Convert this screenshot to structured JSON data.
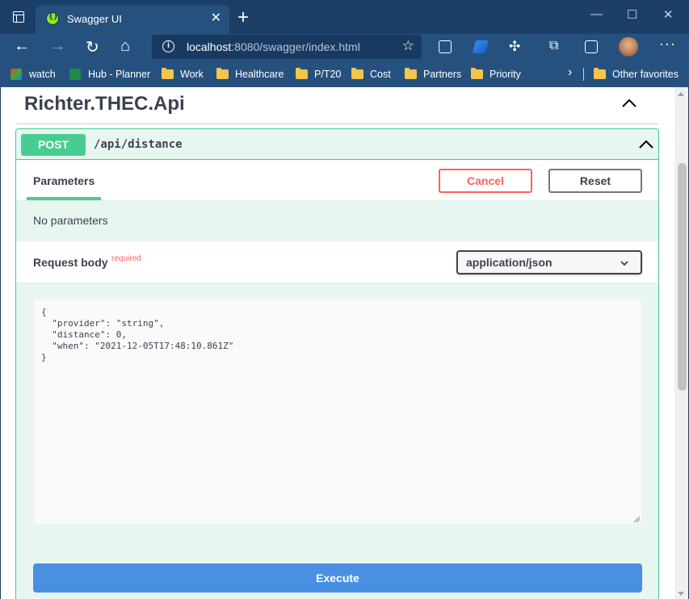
{
  "browser": {
    "tab_title": "Swagger UI",
    "tab_close": "✕",
    "new_tab": "+",
    "window_controls": {
      "minimize": "—",
      "maximize": "☐",
      "close": "✕"
    },
    "nav": {
      "back": "←",
      "forward": "→",
      "refresh": "↻",
      "home": "⌂"
    },
    "url_host": "localhost",
    "url_path": ":8080/swagger/index.html",
    "more_label": "···",
    "favorites": [
      {
        "label": "watch",
        "icon": "watch-site-icon"
      },
      {
        "label": "Hub - Planner",
        "icon": "planner-icon"
      },
      {
        "label": "Work",
        "icon": "folder-icon"
      },
      {
        "label": "Healthcare",
        "icon": "folder-icon"
      },
      {
        "label": "P/T20",
        "icon": "folder-icon"
      },
      {
        "label": "Cost",
        "icon": "folder-icon"
      },
      {
        "label": "Partners",
        "icon": "folder-icon"
      },
      {
        "label": "Priority",
        "icon": "folder-icon"
      }
    ],
    "favorites_overflow": "›",
    "other_favorites": "Other favorites"
  },
  "page": {
    "api_title": "Richter.THEC.Api",
    "operation": {
      "method": "POST",
      "path": "/api/distance",
      "parameters_tab": "Parameters",
      "cancel_label": "Cancel",
      "reset_label": "Reset",
      "no_parameters": "No parameters",
      "request_body_label": "Request body",
      "required_label": "required",
      "content_type": "application/json",
      "body": "{\n  \"provider\": \"string\",\n  \"distance\": 0,\n  \"when\": \"2021-12-05T17:48:10.861Z\"\n}",
      "execute_label": "Execute"
    }
  },
  "colors": {
    "post_green": "#49cc90",
    "cancel_red": "#ff6060",
    "execute_blue": "#4990e2",
    "browser_chrome": "#1c3f68"
  }
}
